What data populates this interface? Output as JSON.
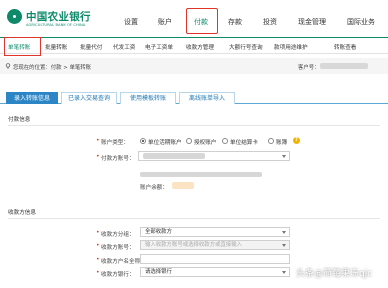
{
  "brand": {
    "name_cn": "中国农业银行",
    "name_en": "AGRICULTURAL BANK OF CHINA"
  },
  "top_nav": [
    {
      "label": "设置"
    },
    {
      "label": "账户"
    },
    {
      "label": "付款",
      "active": true
    },
    {
      "label": "存款"
    },
    {
      "label": "投资"
    },
    {
      "label": "现金管理"
    },
    {
      "label": "国际业务"
    }
  ],
  "sub_nav": [
    {
      "label": "单笔转账",
      "active": true
    },
    {
      "label": "批量转账"
    },
    {
      "label": "批量代付"
    },
    {
      "label": "代发工资"
    },
    {
      "label": "电子工资单"
    },
    {
      "label": "收款方管理"
    },
    {
      "label": "大额行号查询"
    },
    {
      "label": "款项用途维护"
    },
    {
      "label": "转账查看"
    }
  ],
  "breadcrumb": "您现在的位置：付款 > 单笔转账",
  "client_label": "客户号：",
  "tabs": [
    {
      "label": "录入转账信息",
      "active": true
    },
    {
      "label": "已录入交易查询"
    },
    {
      "label": "使用模板转账"
    },
    {
      "label": "离线账单导入"
    }
  ],
  "payer_section": {
    "title": "付款信息",
    "account_type_label": "账户类型：",
    "account_type_options": [
      {
        "label": "单位活期账户",
        "selected": true
      },
      {
        "label": "授权账户",
        "selected": false
      },
      {
        "label": "单位结算卡",
        "selected": false
      },
      {
        "label": "账簿",
        "selected": false
      }
    ],
    "help_icon": "?",
    "payer_account_label": "付款方账号：",
    "balance_label": "账户余额："
  },
  "payee_section": {
    "title": "收款方信息",
    "category_label": "收款方分组：",
    "category_value": "全部收款方",
    "account_label": "收款方账号：",
    "account_placeholder": "输入收款方账号或选择收款方或直接输入",
    "name_label": "收款方户名全称：",
    "bank_label": "收款方银行：",
    "bank_value": "请选择银行"
  },
  "watermark": "头条@荷莓果冻qjc",
  "colors": {
    "brand_green": "#0e8a6a",
    "highlight_red": "#e0352b",
    "tab_blue": "#2c86c5"
  }
}
